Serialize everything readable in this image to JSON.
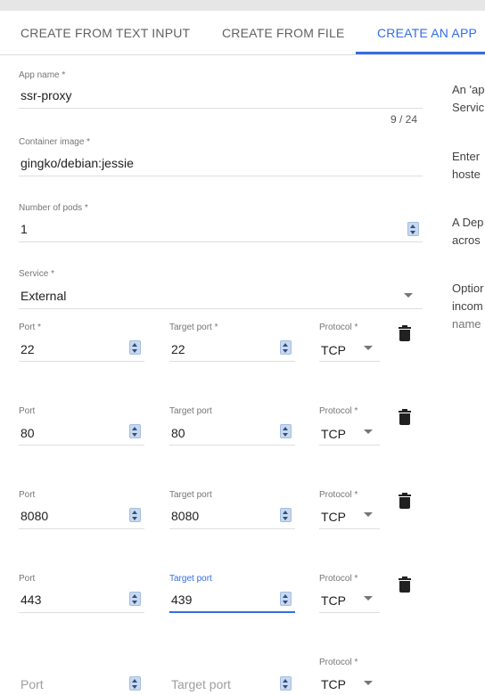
{
  "tabs": [
    {
      "label": "CREATE FROM TEXT INPUT"
    },
    {
      "label": "CREATE FROM FILE"
    },
    {
      "label": "CREATE AN APP"
    }
  ],
  "form": {
    "app_name": {
      "label": "App name *",
      "value": "ssr-proxy",
      "counter": "9 / 24"
    },
    "container_image": {
      "label": "Container image *",
      "value": "gingko/debian:jessie"
    },
    "pods": {
      "label": "Number of pods *",
      "value": "1"
    },
    "service": {
      "label": "Service *",
      "value": "External"
    },
    "port_rows": [
      {
        "port_label": "Port *",
        "port": "22",
        "target_label": "Target port *",
        "target": "22",
        "protocol_label": "Protocol *",
        "protocol": "TCP"
      },
      {
        "port_label": "Port",
        "port": "80",
        "target_label": "Target port",
        "target": "80",
        "protocol_label": "Protocol *",
        "protocol": "TCP"
      },
      {
        "port_label": "Port",
        "port": "8080",
        "target_label": "Target port",
        "target": "8080",
        "protocol_label": "Protocol *",
        "protocol": "TCP"
      },
      {
        "port_label": "Port",
        "port": "443",
        "target_label": "Target port",
        "target": "439",
        "protocol_label": "Protocol *",
        "protocol": "TCP"
      }
    ],
    "empty_row": {
      "port_placeholder": "Port",
      "target_placeholder": "Target port",
      "protocol_label": "Protocol *",
      "protocol": "TCP"
    }
  },
  "side_help": [
    [
      "An 'ap",
      "Servic"
    ],
    [
      "Enter",
      "hoste"
    ],
    [
      "A Dep",
      "acros"
    ],
    [
      "Optior",
      "incom",
      "name"
    ]
  ],
  "colors": {
    "accent": "#326de6",
    "text": "#212121",
    "muted": "#757575",
    "divider": "#dedede"
  }
}
